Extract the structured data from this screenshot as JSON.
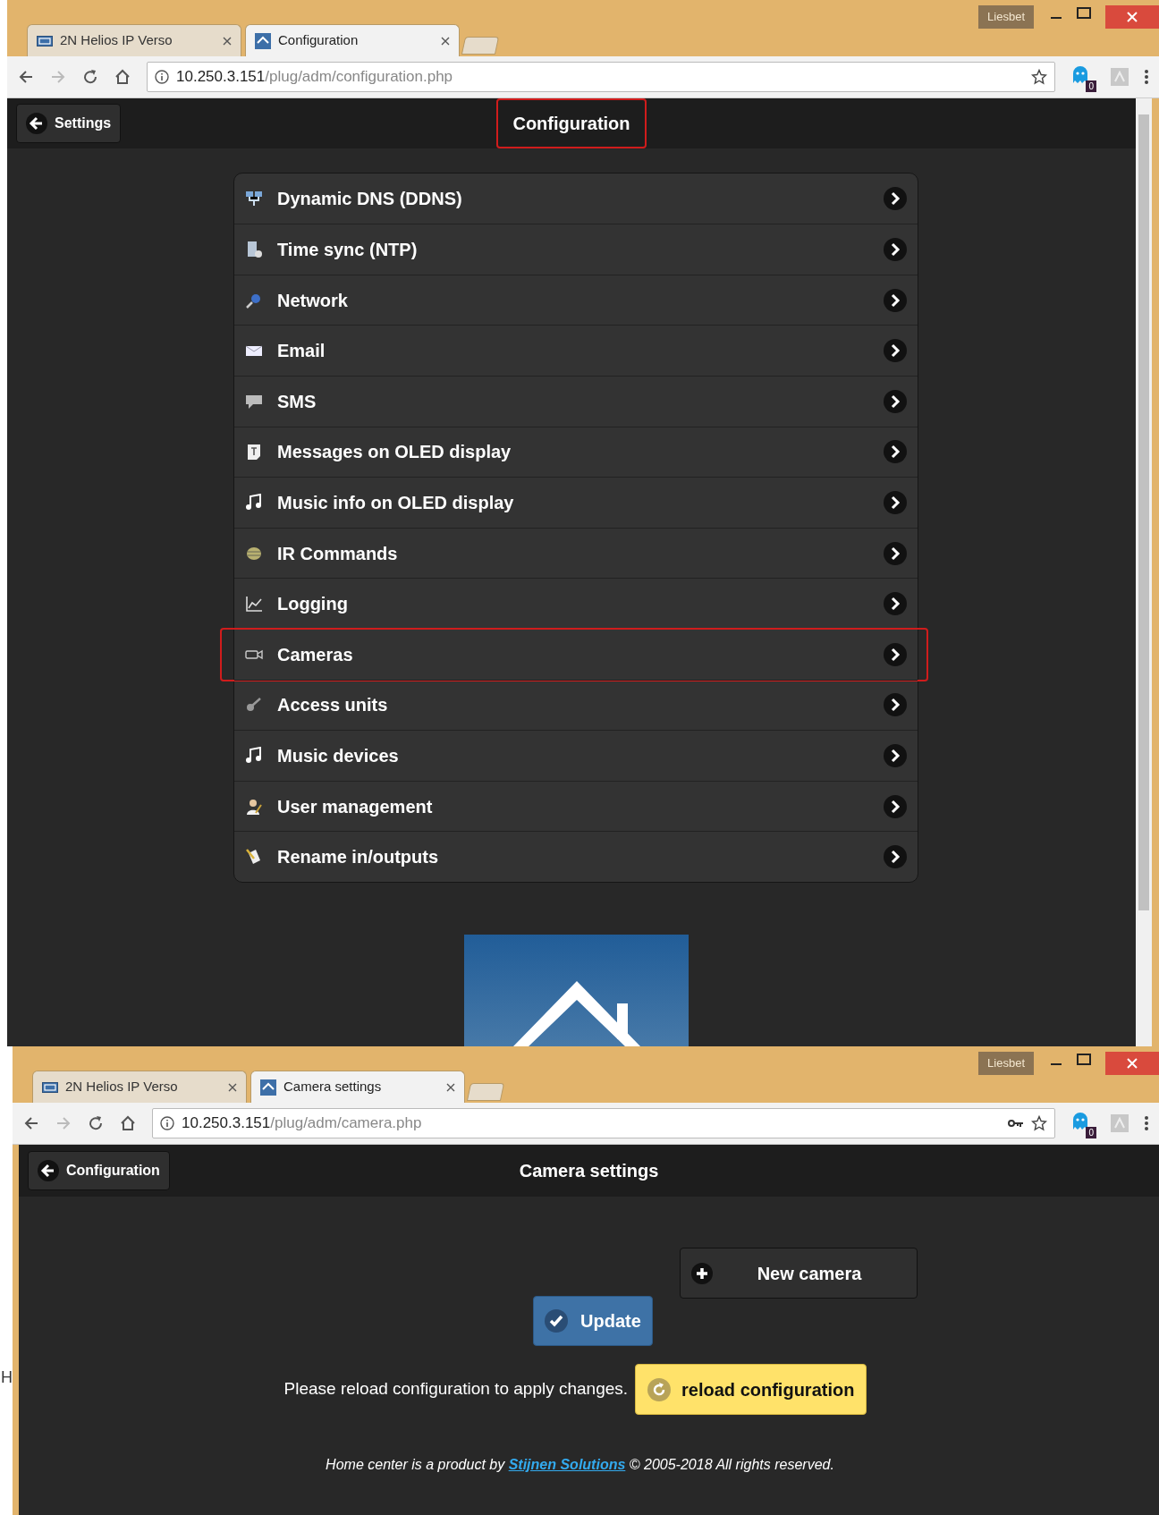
{
  "stray_text": "H",
  "window_1": {
    "tabs": [
      {
        "label": "2N Helios IP Verso",
        "kind": "brand",
        "selected": false
      },
      {
        "label": "Configuration",
        "kind": "home",
        "selected": true
      }
    ],
    "profile": "Liesbet",
    "address": {
      "host": "10.250.3.151",
      "path": "/plug/adm/configuration.php"
    },
    "password_key": false,
    "extension_badge": "0",
    "back_button": "Settings",
    "page_title": {
      "text": "Configuration",
      "highlighted": true
    },
    "menu": [
      {
        "label": "Dynamic DNS (DDNS)",
        "kind": "ddns",
        "highlighted": false
      },
      {
        "label": "Time sync (NTP)",
        "kind": "clock",
        "highlighted": false
      },
      {
        "label": "Network",
        "kind": "network",
        "highlighted": false
      },
      {
        "label": "Email",
        "kind": "mail",
        "highlighted": false
      },
      {
        "label": "SMS",
        "kind": "sms",
        "highlighted": false
      },
      {
        "label": "Messages on OLED display",
        "kind": "text",
        "highlighted": false
      },
      {
        "label": "Music info on OLED display",
        "kind": "note",
        "highlighted": false
      },
      {
        "label": "IR Commands",
        "kind": "ir",
        "highlighted": false
      },
      {
        "label": "Logging",
        "kind": "chart",
        "highlighted": false
      },
      {
        "label": "Cameras",
        "kind": "camera",
        "highlighted": true
      },
      {
        "label": "Access units",
        "kind": "key",
        "highlighted": false
      },
      {
        "label": "Music devices",
        "kind": "note",
        "highlighted": false
      },
      {
        "label": "User management",
        "kind": "user",
        "highlighted": false
      },
      {
        "label": "Rename in/outputs",
        "kind": "rename",
        "highlighted": false
      }
    ]
  },
  "window_2": {
    "tabs": [
      {
        "label": "2N Helios IP Verso",
        "kind": "brand",
        "selected": false
      },
      {
        "label": "Camera settings",
        "kind": "home",
        "selected": true
      }
    ],
    "profile": "Liesbet",
    "address": {
      "host": "10.250.3.151",
      "path": "/plug/adm/camera.php"
    },
    "password_key": true,
    "extension_badge": "0",
    "back_button": "Configuration",
    "page_title": {
      "text": "Camera settings",
      "highlighted": false
    },
    "new_button": "New camera",
    "update_button": "Update",
    "reload_message": "Please reload configuration to apply changes.",
    "reload_button": "reload configuration",
    "footer": {
      "before": "Home center is a product by",
      "link": "Stijnen Solutions",
      "after": "© 2005-2018 All rights reserved."
    }
  }
}
